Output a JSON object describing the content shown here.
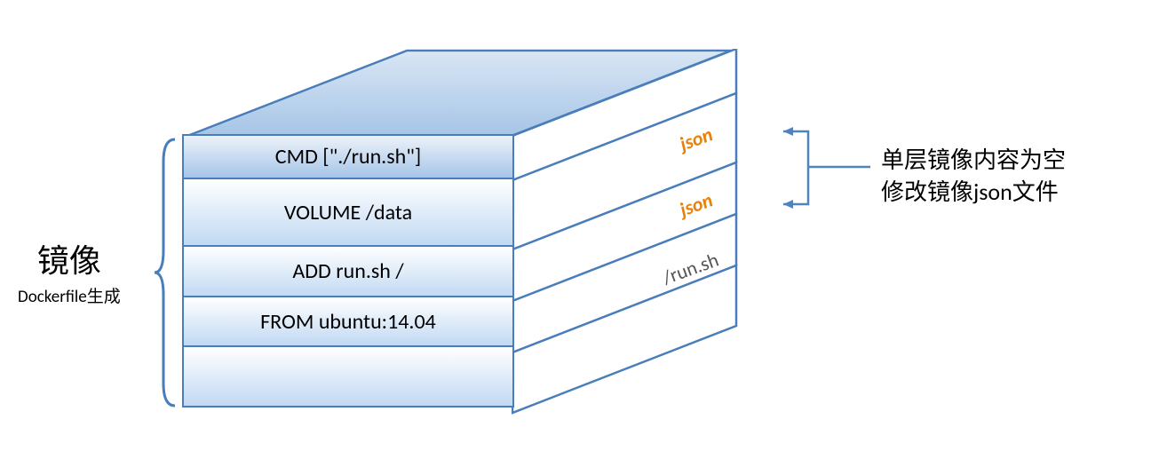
{
  "leftLabel": {
    "title": "镜像",
    "subtitle": "Dockerfile生成"
  },
  "layers": [
    {
      "text": "CMD [\"./run.sh\"]"
    },
    {
      "text": "VOLUME /data"
    },
    {
      "text": "ADD run.sh /"
    },
    {
      "text": "FROM ubuntu:14.04"
    }
  ],
  "sideLabels": {
    "json1": "json",
    "json2": "json",
    "runsh": "/run.sh"
  },
  "rightAnnotation": {
    "line1": "单层镜像内容为空",
    "line2": "修改镜像json文件"
  }
}
